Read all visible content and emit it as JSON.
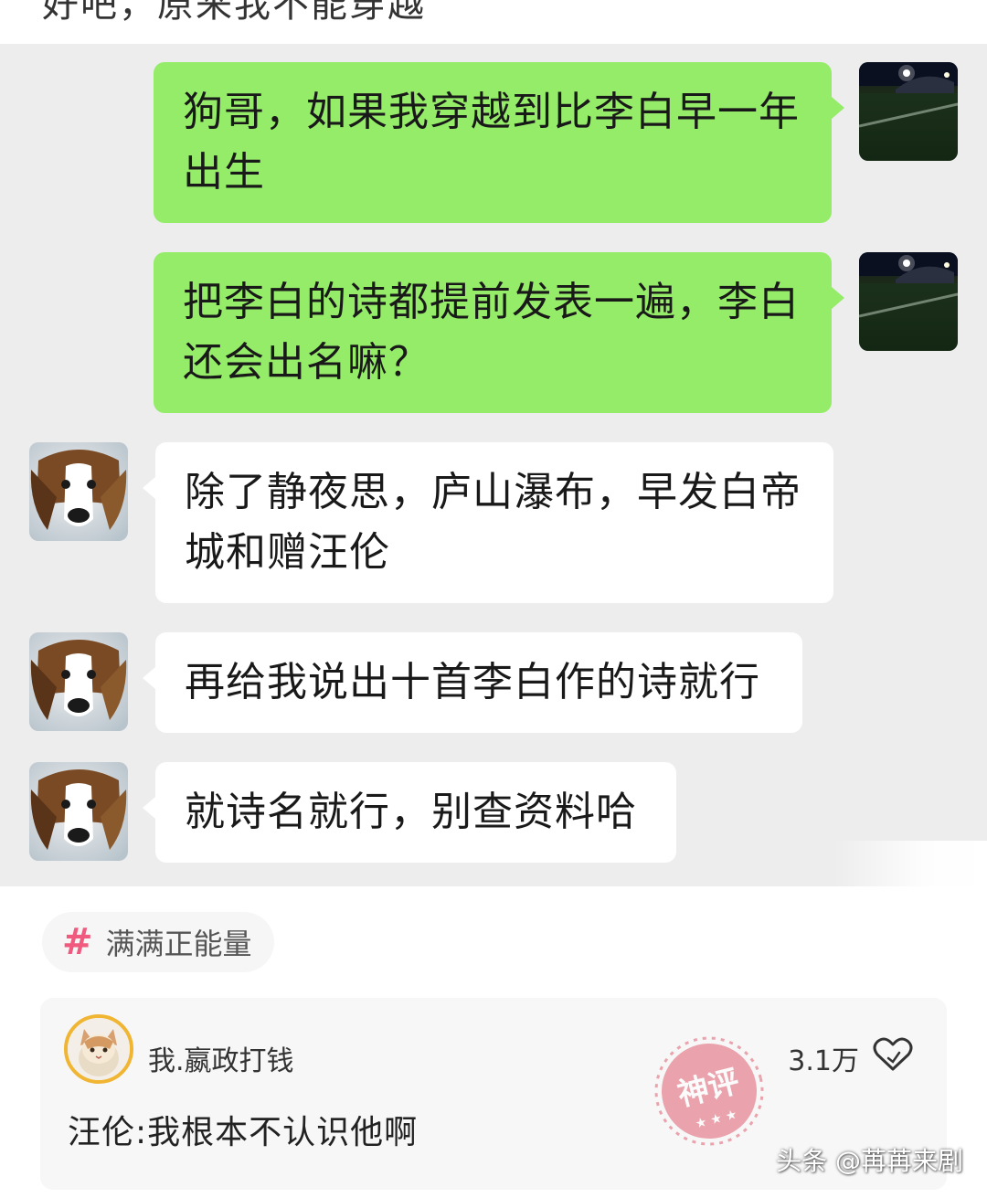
{
  "top_partial_text": "好吧，原来我不能穿越",
  "messages": [
    {
      "sender": "me",
      "avatar": "soccer-field-night-photo",
      "text": "狗哥，如果我穿越到比李白早一年出生"
    },
    {
      "sender": "me",
      "avatar": "soccer-field-night-photo",
      "text": "把李白的诗都提前发表一遍，李白还会出名嘛？"
    },
    {
      "sender": "other",
      "avatar": "saint-bernard-dog-photo",
      "text": "除了静夜思，庐山瀑布，早发白帝城和赠汪伦"
    },
    {
      "sender": "other",
      "avatar": "saint-bernard-dog-photo",
      "text": "再给我说出十首李白作的诗就行"
    },
    {
      "sender": "other",
      "avatar": "saint-bernard-dog-photo",
      "text": "就诗名就行，别查资料哈"
    }
  ],
  "topic_tag": {
    "icon": "hash-icon",
    "label": "满满正能量"
  },
  "top_comment": {
    "username": "我.嬴政打钱",
    "likes": "3.1万",
    "like_icon": "heart-icon",
    "text": "汪伦:我根本不认识他啊",
    "stamp_text": "神评"
  },
  "watermark": "头条 @苒苒来剧",
  "colors": {
    "my_bubble": "#95ec69",
    "other_bubble": "#ffffff",
    "chat_bg": "#ededed",
    "tag_hash": "#f05a7e",
    "stamp": "#e06070"
  }
}
